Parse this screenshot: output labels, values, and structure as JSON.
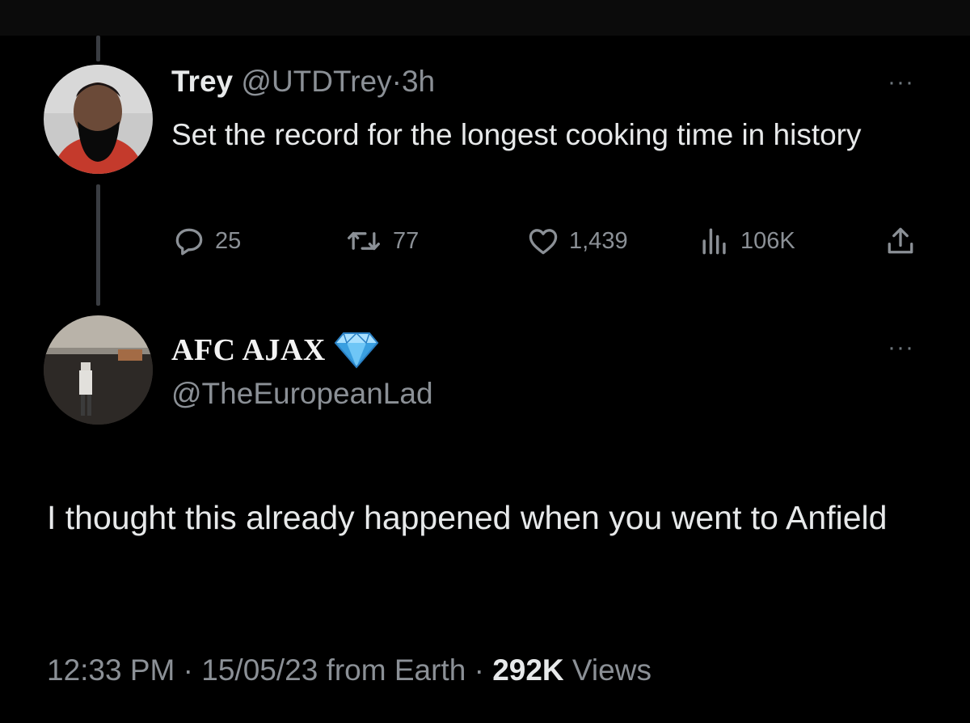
{
  "parent_tweet": {
    "author_name": "Trey",
    "handle": "@UTDTrey",
    "separator": "·",
    "time": "3h",
    "text": "Set the record for the longest cooking time in history",
    "more_label": "···",
    "actions": {
      "replies": "25",
      "retweets": "77",
      "likes": "1,439",
      "views": "106K"
    }
  },
  "reply_tweet": {
    "author_name": "AFC AJAX",
    "badge": "diamond-emoji",
    "handle": "@TheEuropeanLad",
    "more_label": "···",
    "text": "I thought this already happened when you went to Anfield",
    "timestamp": "12:33 PM",
    "sep1": "·",
    "date": "15/05/23",
    "source": "from Earth",
    "sep2": "·",
    "views_count": "292K",
    "views_label": "Views"
  },
  "colors": {
    "background": "#000000",
    "primary_text": "#e7e9ea",
    "secondary_text": "#8b9096",
    "thread_line": "#3a3d42"
  }
}
